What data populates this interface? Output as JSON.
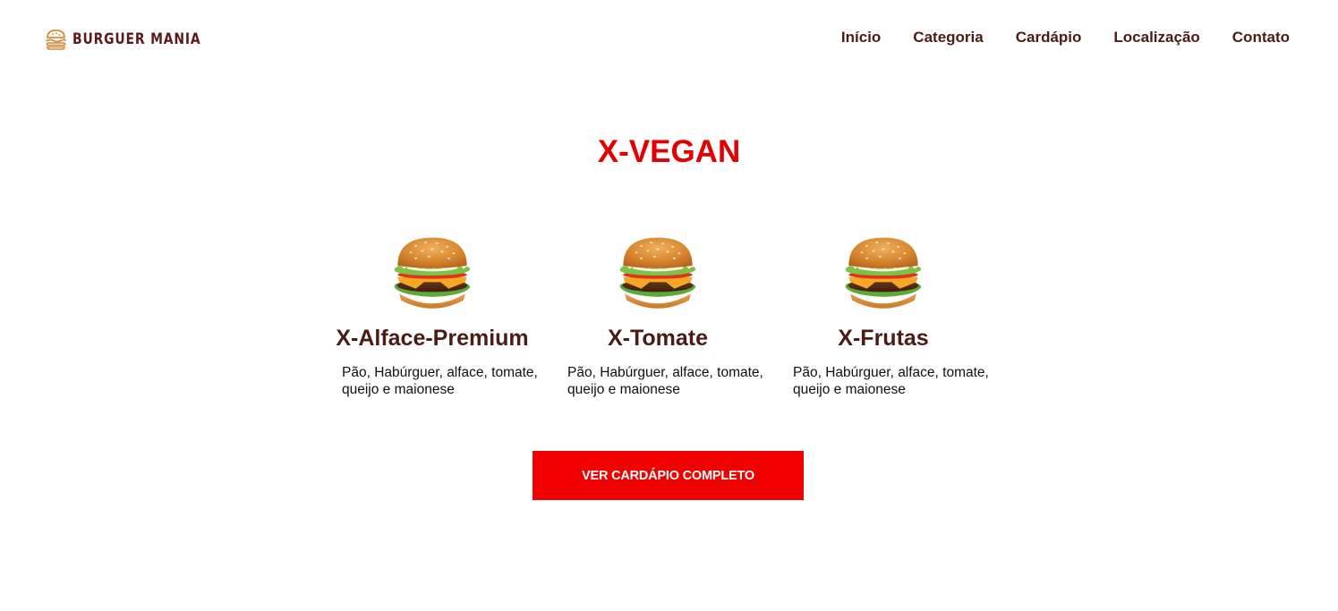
{
  "brand": {
    "name": "BURGUER MANIA",
    "icon": "burger-icon",
    "color": "#5b1a1a"
  },
  "nav": {
    "items": [
      {
        "label": "Início"
      },
      {
        "label": "Categoria"
      },
      {
        "label": "Cardápio"
      },
      {
        "label": "Localização"
      },
      {
        "label": "Contato"
      }
    ]
  },
  "section": {
    "title": "X-VEGAN",
    "title_color": "#e40000"
  },
  "products": [
    {
      "name": "X-Alface-Premium",
      "description": "Pão, Habúrguer, alface, tomate, queijo e maionese",
      "icon": "burger-image"
    },
    {
      "name": "X-Tomate",
      "description": "Pão, Habúrguer, alface, tomate, queijo e maionese",
      "icon": "burger-image"
    },
    {
      "name": "X-Frutas",
      "description": "Pão, Habúrguer, alface, tomate, queijo e maionese",
      "icon": "burger-image"
    }
  ],
  "cta": {
    "label": "VER CARDÁPIO COMPLETO",
    "color": "#f00000"
  }
}
